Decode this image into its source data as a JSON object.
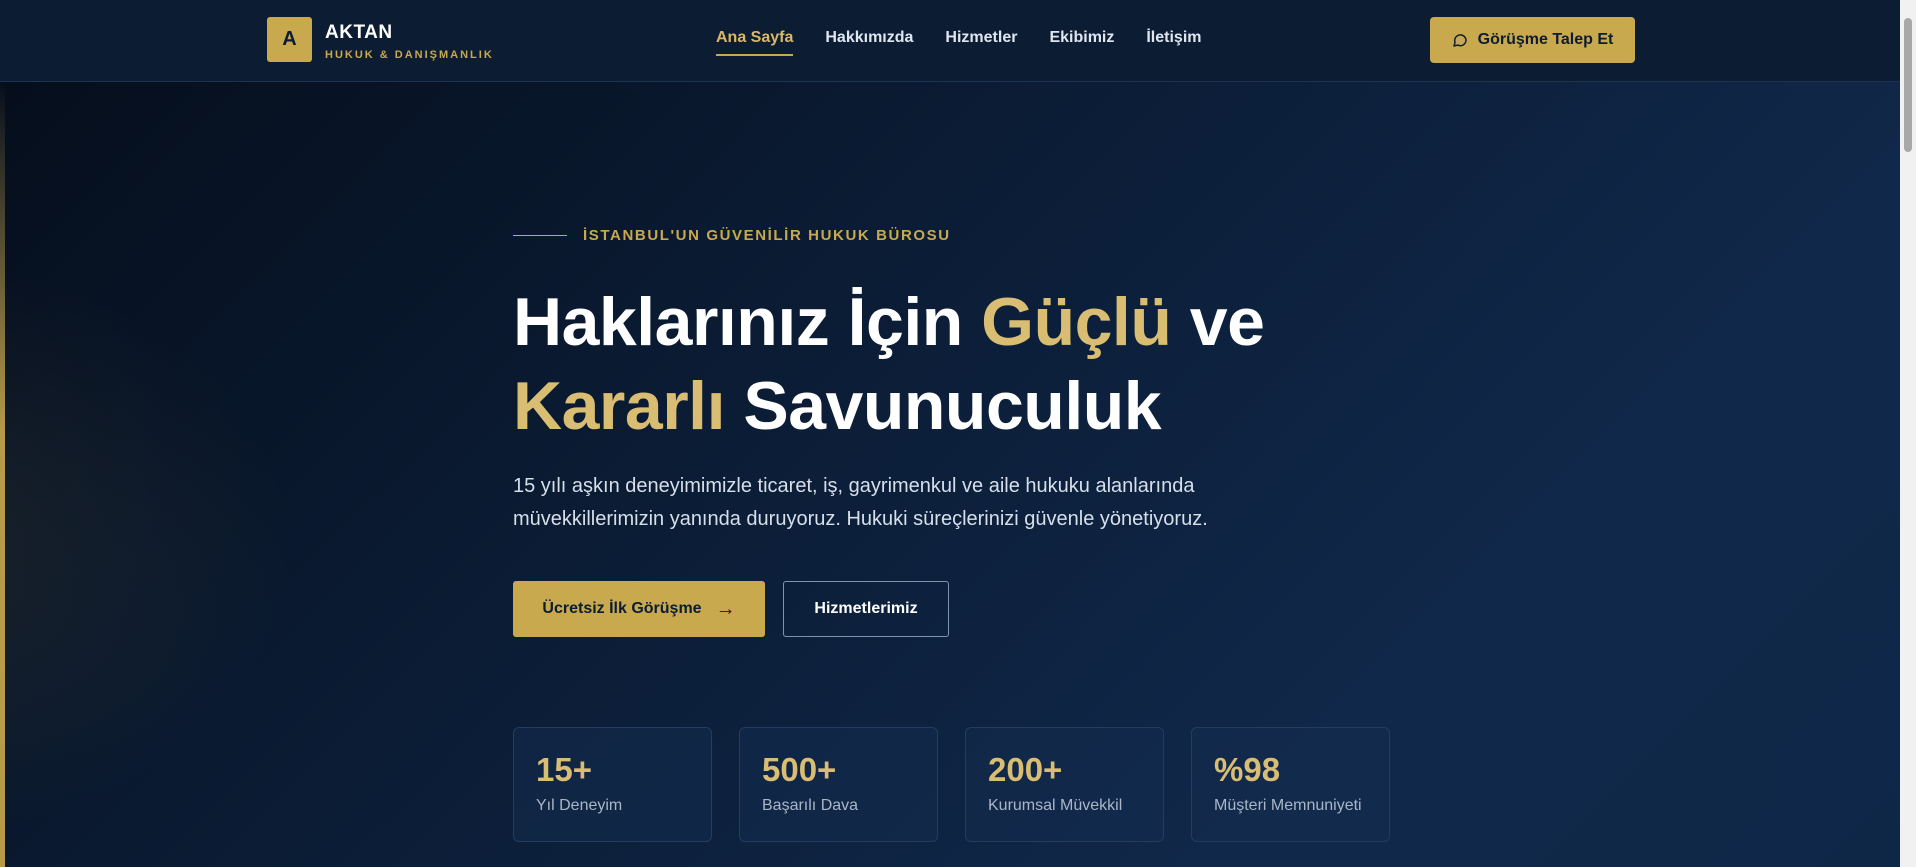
{
  "brand": {
    "logo_letter": "A",
    "name": "AKTAN",
    "subtitle": "HUKUK & DANIŞMANLIK"
  },
  "nav": {
    "items": [
      {
        "label": "Ana Sayfa",
        "active": true
      },
      {
        "label": "Hakkımızda",
        "active": false
      },
      {
        "label": "Hizmetler",
        "active": false
      },
      {
        "label": "Ekibimiz",
        "active": false
      },
      {
        "label": "İletişim",
        "active": false
      }
    ],
    "cta_label": "Görüşme Talep Et",
    "cta_icon": "chat-icon"
  },
  "hero": {
    "eyebrow": "İSTANBUL'UN GÜVENİLİR HUKUK BÜROSU",
    "title_part1": "Haklarınız İçin ",
    "title_gold1": "Güçlü",
    "title_part2": " ve",
    "title_gold2": "Kararlı",
    "title_part3": " Savunuculuk",
    "description_line1": "15 yılı aşkın deneyimimizle ticaret, iş, gayrimenkul ve aile hukuku alanlarında",
    "description_line2": "müvekkillerimizin yanında duruyoruz. Hukuki süreçlerinizi güvenle yönetiyoruz.",
    "primary_button": "Ücretsiz İlk Görüşme",
    "primary_button_icon": "→",
    "secondary_button": "Hizmetlerimiz"
  },
  "stats": [
    {
      "value": "15+",
      "label": "Yıl Deneyim"
    },
    {
      "value": "500+",
      "label": "Başarılı Dava"
    },
    {
      "value": "200+",
      "label": "Kurumsal Müvekkil"
    },
    {
      "value": "%98",
      "label": "Müşteri Memnuniyeti"
    }
  ],
  "colors": {
    "accent": "#c9a94d",
    "navy": "#0b1c33"
  }
}
